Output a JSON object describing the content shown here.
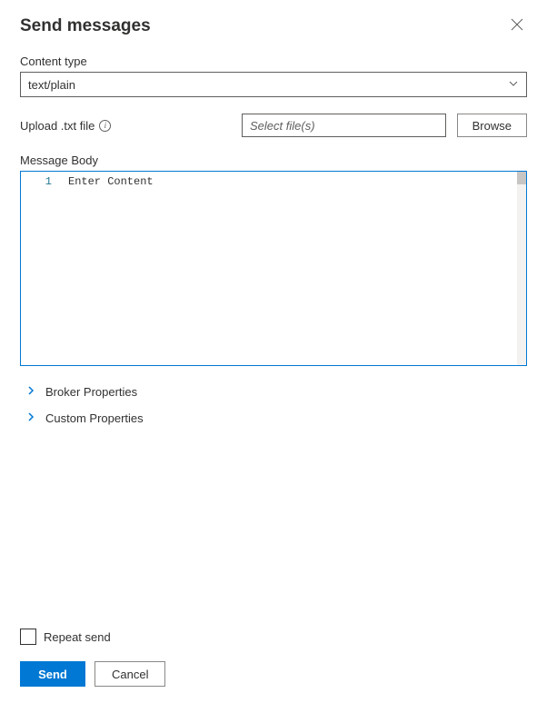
{
  "header": {
    "title": "Send messages"
  },
  "contentType": {
    "label": "Content type",
    "value": "text/plain"
  },
  "upload": {
    "label": "Upload .txt file",
    "placeholder": "Select file(s)",
    "browse_label": "Browse"
  },
  "messageBody": {
    "label": "Message Body",
    "lineNumber": "1",
    "placeholder": "Enter Content"
  },
  "expanders": {
    "broker": "Broker Properties",
    "custom": "Custom Properties"
  },
  "footer": {
    "repeat_label": "Repeat send",
    "send_label": "Send",
    "cancel_label": "Cancel"
  }
}
